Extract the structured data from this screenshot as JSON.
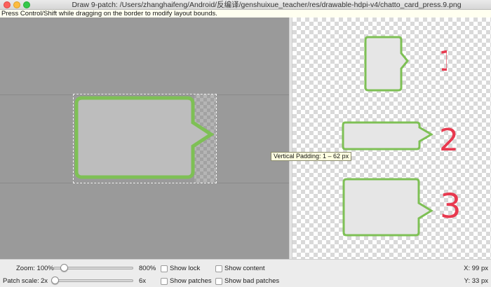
{
  "window": {
    "title": "Draw 9-patch: /Users/zhanghaifeng/Android/反编译/genshuixue_teacher/res/drawable-hdpi-v4/chatto_card_press.9.png"
  },
  "hint": "Press Control/Shift while dragging on the border to modify layout bounds.",
  "tooltip": "Vertical Padding: 1 – 62 px",
  "annotations": [
    "1",
    "2",
    "3"
  ],
  "controls": {
    "zoom_label": "Zoom: 100%",
    "zoom_max": "800%",
    "zoom_value_percent": 100,
    "patch_scale_label": "Patch scale:",
    "patch_scale_min": "2x",
    "patch_scale_max": "6x",
    "patch_scale_value": 2,
    "show_lock": "Show lock",
    "show_patches": "Show patches",
    "show_content": "Show content",
    "show_bad_patches": "Show bad patches"
  },
  "status": {
    "x": "X: 99 px",
    "y": "Y: 33 px"
  },
  "colors": {
    "bubble_stroke": "#7ec055",
    "bubble_fill": "#e6e6e6",
    "annotation": "#e8394f",
    "editor_bg": "#9a9a9a"
  }
}
